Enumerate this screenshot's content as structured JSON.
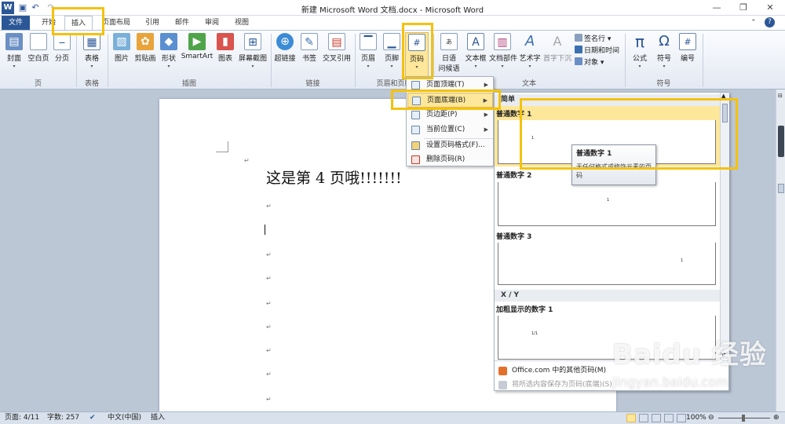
{
  "window": {
    "title": "新建 Microsoft Word 文档.docx - Microsoft Word"
  },
  "tabs": [
    {
      "label": "文件"
    },
    {
      "label": "开始"
    },
    {
      "label": "插入"
    },
    {
      "label": "页面布局"
    },
    {
      "label": "引用"
    },
    {
      "label": "邮件"
    },
    {
      "label": "审阅"
    },
    {
      "label": "视图"
    }
  ],
  "ribbon": {
    "buttons": [
      {
        "label": "封面",
        "icon": "cover-page-icon"
      },
      {
        "label": "空白页",
        "icon": "blank-page-icon"
      },
      {
        "label": "分页",
        "icon": "page-break-icon"
      },
      {
        "label": "表格",
        "icon": "table-icon"
      },
      {
        "label": "图片",
        "icon": "picture-icon"
      },
      {
        "label": "剪贴画",
        "icon": "clip-art-icon"
      },
      {
        "label": "形状",
        "icon": "shapes-icon"
      },
      {
        "label": "SmartArt",
        "icon": "smartart-icon"
      },
      {
        "label": "图表",
        "icon": "chart-icon"
      },
      {
        "label": "屏幕截图",
        "icon": "screenshot-icon"
      },
      {
        "label": "超链接",
        "icon": "hyperlink-icon"
      },
      {
        "label": "书签",
        "icon": "bookmark-icon"
      },
      {
        "label": "交叉引用",
        "icon": "cross-reference-icon"
      },
      {
        "label": "页眉",
        "icon": "header-icon"
      },
      {
        "label": "页脚",
        "icon": "footer-icon"
      },
      {
        "label": "页码",
        "icon": "page-number-icon"
      },
      {
        "label": "日语",
        "label2": "问候语",
        "icon": "greeting-icon"
      },
      {
        "label": "文本框",
        "icon": "text-box-icon"
      },
      {
        "label": "文档部件",
        "icon": "quick-parts-icon"
      },
      {
        "label": "艺术字",
        "icon": "wordart-icon"
      },
      {
        "label": "首字下沉",
        "icon": "drop-cap-icon"
      },
      {
        "label": "公式",
        "icon": "equation-icon"
      },
      {
        "label": "符号",
        "icon": "symbol-icon"
      },
      {
        "label": "编号",
        "icon": "number-icon"
      }
    ],
    "small_buttons": [
      {
        "label": "签名行 ▾"
      },
      {
        "label": "日期和时间"
      },
      {
        "label": "对象 ▾"
      }
    ],
    "groups": [
      {
        "label": "页"
      },
      {
        "label": "表格"
      },
      {
        "label": "插图"
      },
      {
        "label": "链接"
      },
      {
        "label": "页眉和页脚"
      },
      {
        "label": "文本"
      },
      {
        "label": "符号"
      }
    ]
  },
  "document": {
    "heading": "这是第 4 页哦!!!!!!!",
    "paragraph_mark": "↵"
  },
  "page_number_menu": {
    "items": [
      {
        "label": "页面顶端(T)"
      },
      {
        "label": "页面底端(B)"
      },
      {
        "label": "页边距(P)"
      },
      {
        "label": "当前位置(C)"
      },
      {
        "label": "设置页码格式(F)..."
      },
      {
        "label": "删除页码(R)"
      }
    ]
  },
  "gallery": {
    "section_simple": "简单",
    "section_xy": "X / Y",
    "items": [
      {
        "name": "普通数字 1"
      },
      {
        "name": "普通数字 2"
      },
      {
        "name": "普通数字 3"
      },
      {
        "name": "加粗显示的数字 1"
      }
    ],
    "thumb_num": "1",
    "thumb_xy": "1/1",
    "footer": [
      {
        "label": "Office.com 中的其他页码(M)"
      },
      {
        "label": "将所选内容保存为页码(底端)(S)"
      }
    ]
  },
  "tooltip": {
    "title": "普通数字 1",
    "desc": "无任何格式或修饰元素的页码"
  },
  "status": {
    "page": "页面: 4/11",
    "words": "字数: 257",
    "language": "中文(中国)",
    "mode": "插入",
    "zoom": "100%"
  },
  "watermark": {
    "brand": "Baidu 经验",
    "url": "jingyan.baidu.com"
  },
  "colors": {
    "accent": "#2b5797",
    "highlight": "#f4c20d",
    "menu_hover": "#fde79a"
  }
}
